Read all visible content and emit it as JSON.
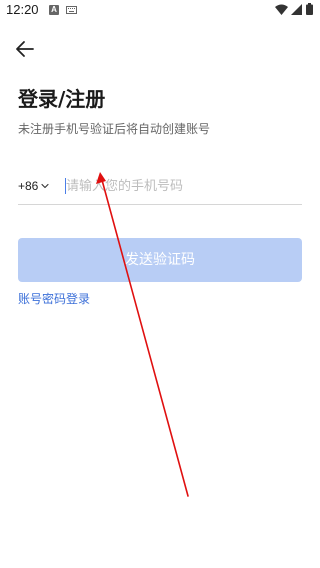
{
  "status_bar": {
    "time": "12:20",
    "notification_letter": "A",
    "icons": [
      "notification-a-icon",
      "keyboard-icon",
      "wifi-icon",
      "signal-icon",
      "battery-icon"
    ]
  },
  "header": {
    "back_icon": "arrow-left-icon"
  },
  "main": {
    "title": "登录/注册",
    "subtitle": "未注册手机号验证后将自动创建账号",
    "country_code": "+86",
    "phone_placeholder": "请输入您的手机号码",
    "phone_value": "",
    "send_code_label": "发送验证码",
    "password_login_label": "账号密码登录"
  },
  "colors": {
    "primary_link": "#3b6fd8",
    "button_disabled": "#b8cdf5",
    "annotation_arrow": "#e01010"
  }
}
